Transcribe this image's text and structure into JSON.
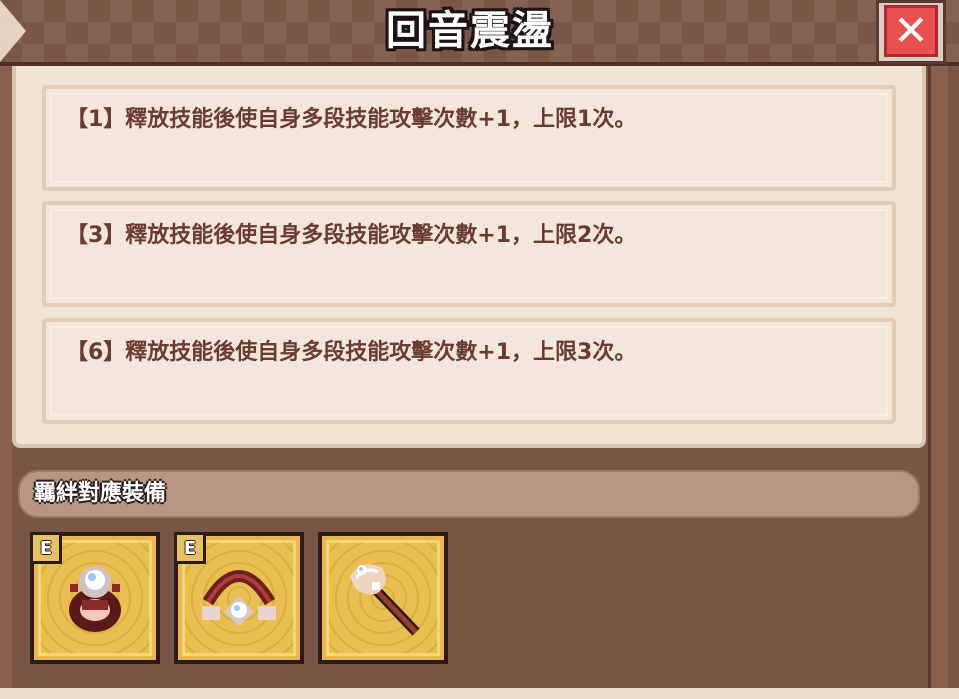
{
  "header": {
    "title": "回音震盪",
    "close_icon": "close-icon"
  },
  "effects": [
    {
      "text": "【1】釋放技能後使自身多段技能攻擊次數+1，上限1次。"
    },
    {
      "text": "【3】釋放技能後使自身多段技能攻擊次數+1，上限2次。"
    },
    {
      "text": "【6】釋放技能後使自身多段技能攻擊次數+1，上限3次。"
    }
  ],
  "equipment_section": {
    "title": "羈絆對應裝備",
    "items": [
      {
        "icon": "gem-ring-icon",
        "badge": "E"
      },
      {
        "icon": "gem-bracelet-icon",
        "badge": "E"
      },
      {
        "icon": "gem-staff-icon"
      }
    ]
  },
  "colors": {
    "frame_brown": "#7a5444",
    "content_bg": "#efe4d6",
    "effect_text": "#6b3b33",
    "slot_gold": "#e6b94a",
    "close_red": "#e8514f"
  }
}
